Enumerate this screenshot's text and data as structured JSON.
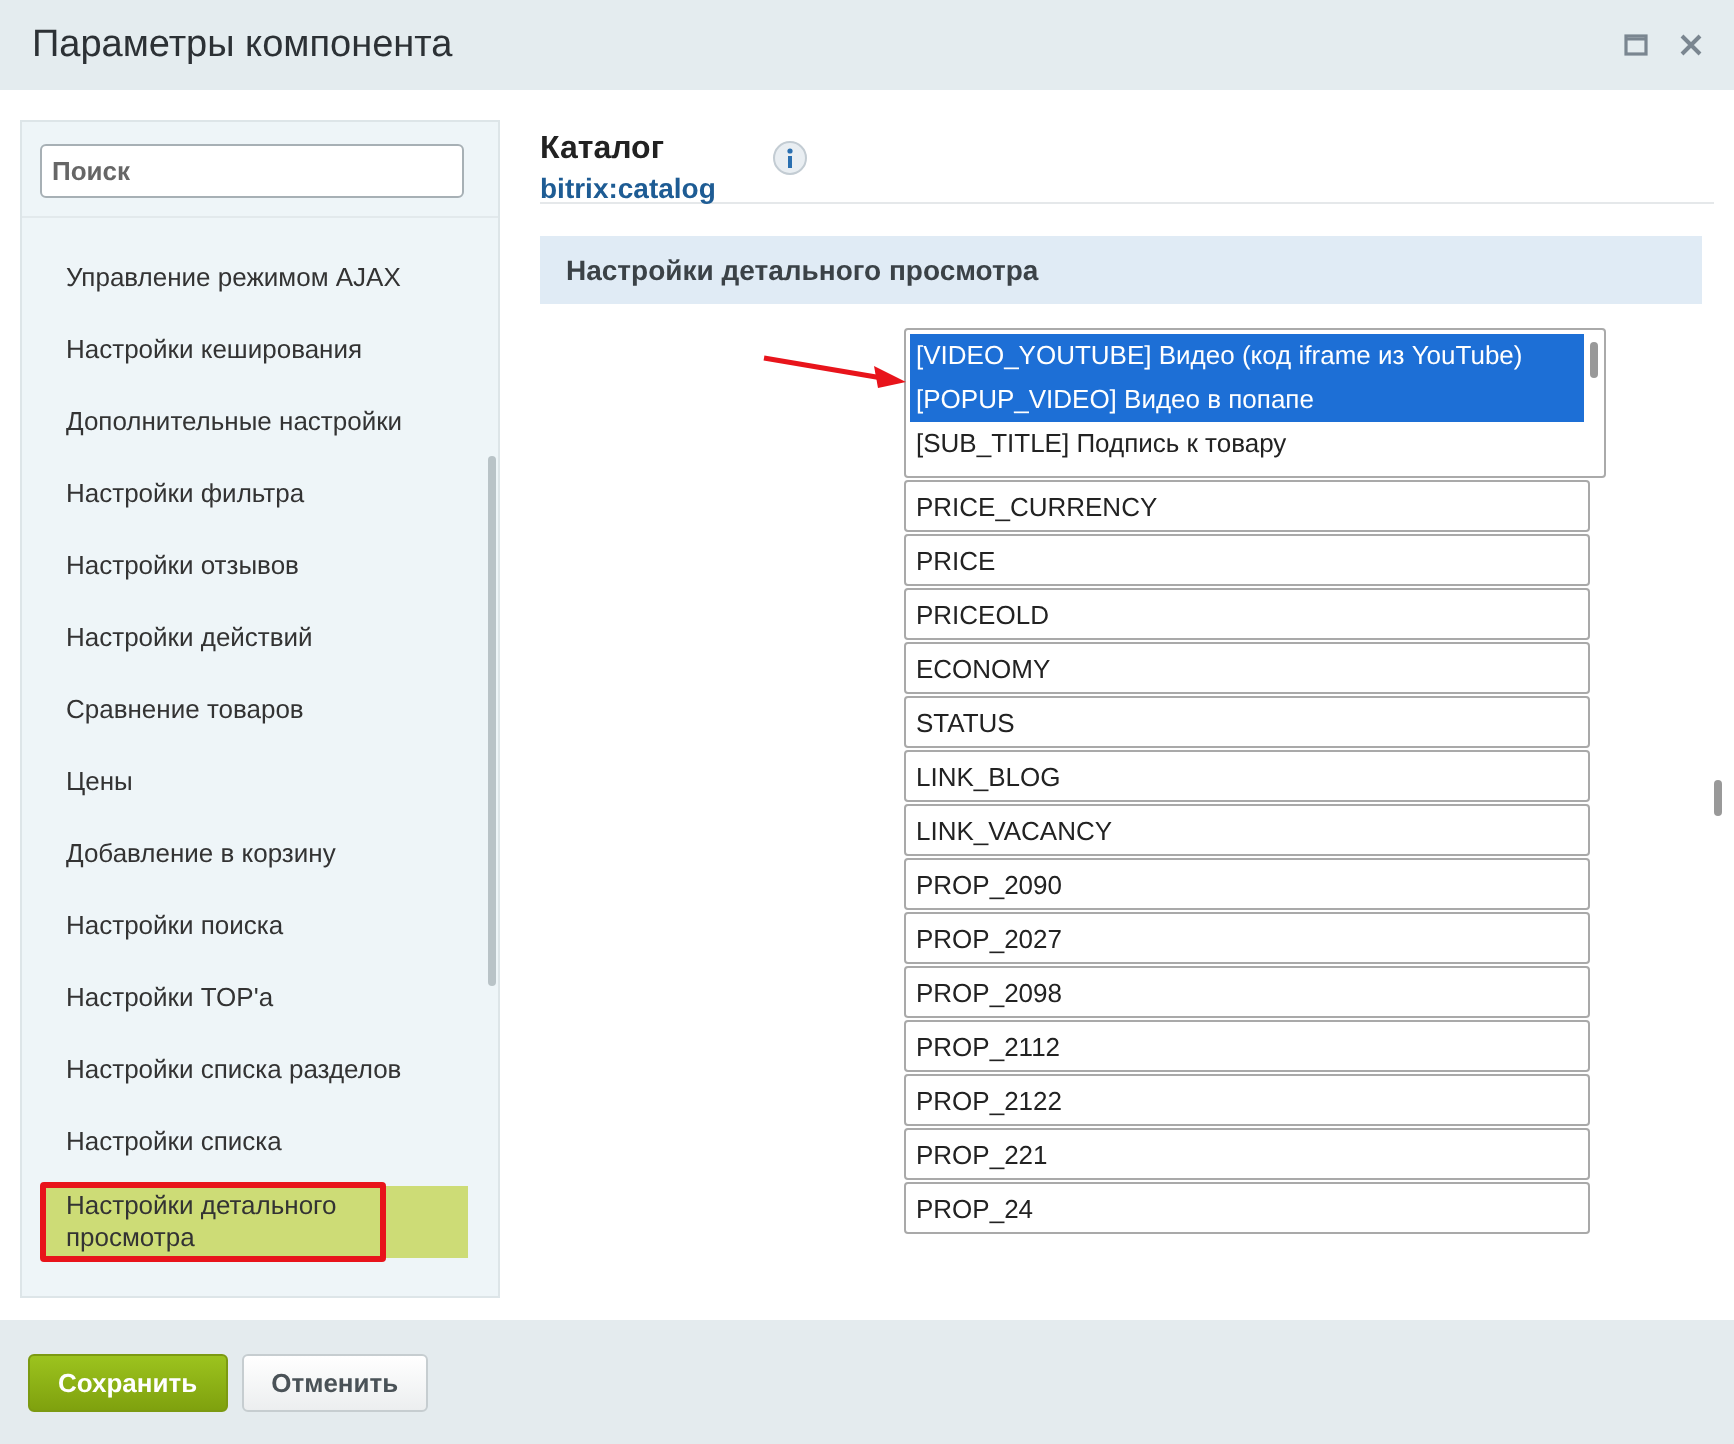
{
  "window": {
    "title": "Параметры компонента"
  },
  "sidebar": {
    "search": {
      "placeholder": "Поиск"
    },
    "items": [
      {
        "label": "Управление режимом AJAX",
        "selected": false
      },
      {
        "label": "Настройки кеширования",
        "selected": false
      },
      {
        "label": "Дополнительные настройки",
        "selected": false
      },
      {
        "label": "Настройки фильтра",
        "selected": false
      },
      {
        "label": "Настройки отзывов",
        "selected": false
      },
      {
        "label": "Настройки действий",
        "selected": false
      },
      {
        "label": "Сравнение товаров",
        "selected": false
      },
      {
        "label": "Цены",
        "selected": false
      },
      {
        "label": "Добавление в корзину",
        "selected": false
      },
      {
        "label": "Настройки поиска",
        "selected": false
      },
      {
        "label": "Настройки TOP'а",
        "selected": false
      },
      {
        "label": "Настройки списка разделов",
        "selected": false
      },
      {
        "label": "Настройки списка",
        "selected": false
      },
      {
        "label": "Настройки детального просмотра",
        "selected": true
      }
    ]
  },
  "component": {
    "title": "Каталог",
    "code": "bitrix:catalog"
  },
  "section": {
    "title": "Настройки детального просмотра",
    "multiselect": [
      {
        "label": "[VIDEO_YOUTUBE] Видео (код iframe из YouTube)",
        "selected": true
      },
      {
        "label": "[POPUP_VIDEO] Видео в попапе",
        "selected": true
      },
      {
        "label": "[SUB_TITLE] Подпись к товару",
        "selected": false
      }
    ],
    "fields": [
      {
        "value": "PRICE_CURRENCY"
      },
      {
        "value": "PRICE"
      },
      {
        "value": "PRICEOLD"
      },
      {
        "value": "ECONOMY"
      },
      {
        "value": "STATUS"
      },
      {
        "value": "LINK_BLOG"
      },
      {
        "value": "LINK_VACANCY"
      },
      {
        "value": "PROP_2090"
      },
      {
        "value": "PROP_2027"
      },
      {
        "value": "PROP_2098"
      },
      {
        "value": "PROP_2112"
      },
      {
        "value": "PROP_2122"
      },
      {
        "value": "PROP_221"
      },
      {
        "value": "PROP_24"
      }
    ]
  },
  "buttons": [
    {
      "label": "Сохранить",
      "kind": "primary"
    },
    {
      "label": "Отменить",
      "kind": "secondary"
    }
  ]
}
